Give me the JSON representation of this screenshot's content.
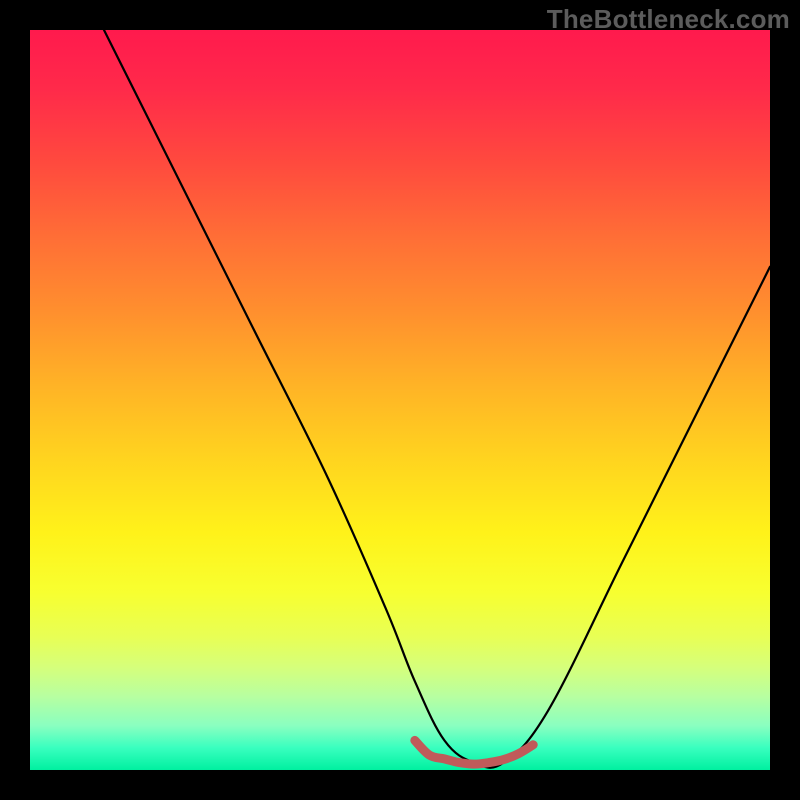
{
  "watermark": "TheBottleneck.com",
  "chart_data": {
    "type": "line",
    "title": "",
    "xlabel": "",
    "ylabel": "",
    "xlim": [
      0,
      100
    ],
    "ylim": [
      0,
      100
    ],
    "grid": false,
    "legend": false,
    "annotations": [],
    "series": [
      {
        "name": "main-curve",
        "color": "#000000",
        "x": [
          10,
          20,
          30,
          40,
          48,
          52,
          56,
          60,
          64,
          70,
          80,
          90,
          100
        ],
        "y": [
          100,
          80,
          60,
          40,
          22,
          12,
          4,
          1,
          1,
          8,
          28,
          48,
          68
        ]
      },
      {
        "name": "bottom-marker",
        "color": "#c05a5a",
        "x": [
          52,
          54,
          56,
          58,
          60,
          62,
          64,
          66,
          68
        ],
        "y": [
          4,
          2,
          1.5,
          1,
          0.8,
          1,
          1.4,
          2.2,
          3.4
        ]
      }
    ],
    "background_gradient_stops": [
      {
        "pos": 0,
        "color": "#ff1a4d"
      },
      {
        "pos": 8,
        "color": "#ff2a4a"
      },
      {
        "pos": 18,
        "color": "#ff4a3e"
      },
      {
        "pos": 28,
        "color": "#ff6e36"
      },
      {
        "pos": 38,
        "color": "#ff8f2e"
      },
      {
        "pos": 48,
        "color": "#ffb326"
      },
      {
        "pos": 58,
        "color": "#ffd41f"
      },
      {
        "pos": 68,
        "color": "#fff21a"
      },
      {
        "pos": 76,
        "color": "#f7ff30"
      },
      {
        "pos": 82,
        "color": "#e8ff55"
      },
      {
        "pos": 86,
        "color": "#d6ff7a"
      },
      {
        "pos": 90,
        "color": "#b8ffa0"
      },
      {
        "pos": 94,
        "color": "#8affc0"
      },
      {
        "pos": 97,
        "color": "#39ffbf"
      },
      {
        "pos": 100,
        "color": "#00f0a0"
      }
    ]
  }
}
